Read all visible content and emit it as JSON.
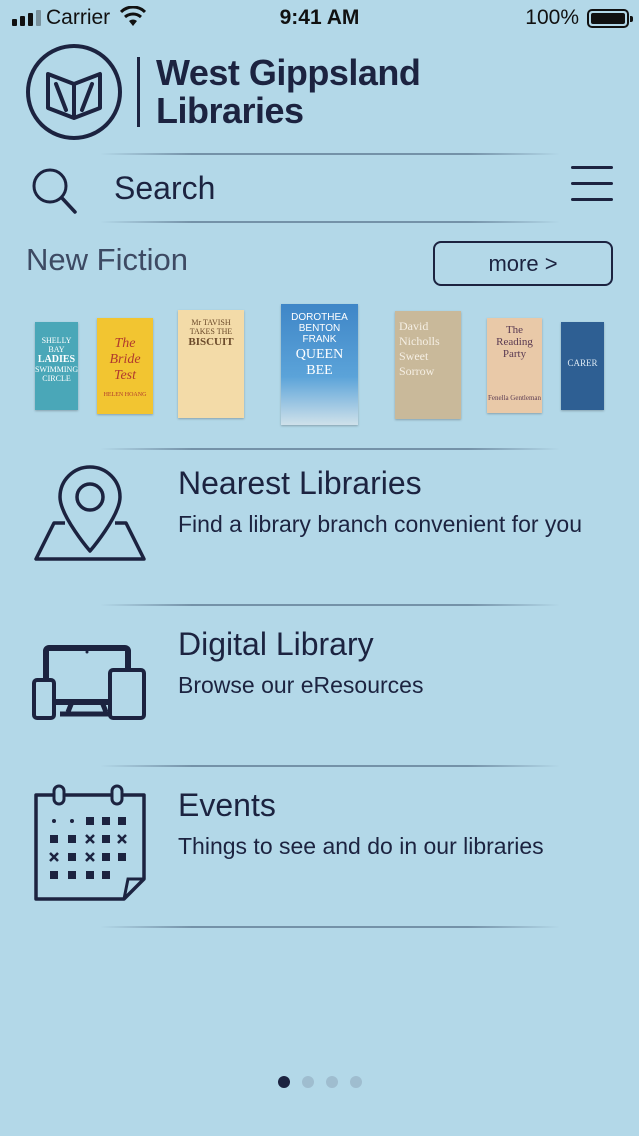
{
  "status_bar": {
    "carrier": "Carrier",
    "time": "9:41 AM",
    "battery": "100%"
  },
  "header": {
    "org_name_line1": "West Gippsland",
    "org_name_line2": "Libraries"
  },
  "search": {
    "placeholder": "Search"
  },
  "new_fiction": {
    "title": "New Fiction",
    "more_label": "more >",
    "books": [
      {
        "line1": "SHELLY BAY",
        "line2": "LADIES",
        "line3": "SWIMMING",
        "line4": "CIRCLE",
        "bg": "#4aa7b8"
      },
      {
        "line1": "The",
        "line2": "Bride",
        "line3": "Test",
        "line4": "HELEN HOANG",
        "bg": "#f2c531"
      },
      {
        "line1": "Mr TAVISH",
        "line2": "TAKES THE",
        "line3": "BISCUIT",
        "line4": "",
        "bg": "#f3dba8"
      },
      {
        "line1": "DOROTHEA",
        "line2": "BENTON",
        "line3": "FRANK",
        "line4": "QUEEN BEE",
        "bg": "#3f86c7"
      },
      {
        "line1": "David",
        "line2": "Nicholls",
        "line3": "Sweet",
        "line4": "Sorrow",
        "bg": "#c9b99a"
      },
      {
        "line1": "The",
        "line2": "Reading",
        "line3": "Party",
        "line4": "Fenella Gentleman",
        "bg": "#e9c9a8"
      },
      {
        "line1": "",
        "line2": "",
        "line3": "CARER",
        "line4": "",
        "bg": "#2e5f93"
      }
    ]
  },
  "items": [
    {
      "title": "Nearest Libraries",
      "subtitle": "Find a library branch convenient for you",
      "icon": "map-pin-icon"
    },
    {
      "title": "Digital Library",
      "subtitle": "Browse our eResources",
      "icon": "devices-icon"
    },
    {
      "title": "Events",
      "subtitle": "Things to see and do in our libraries",
      "icon": "calendar-icon"
    }
  ],
  "pager": {
    "count": 4,
    "active": 1
  }
}
